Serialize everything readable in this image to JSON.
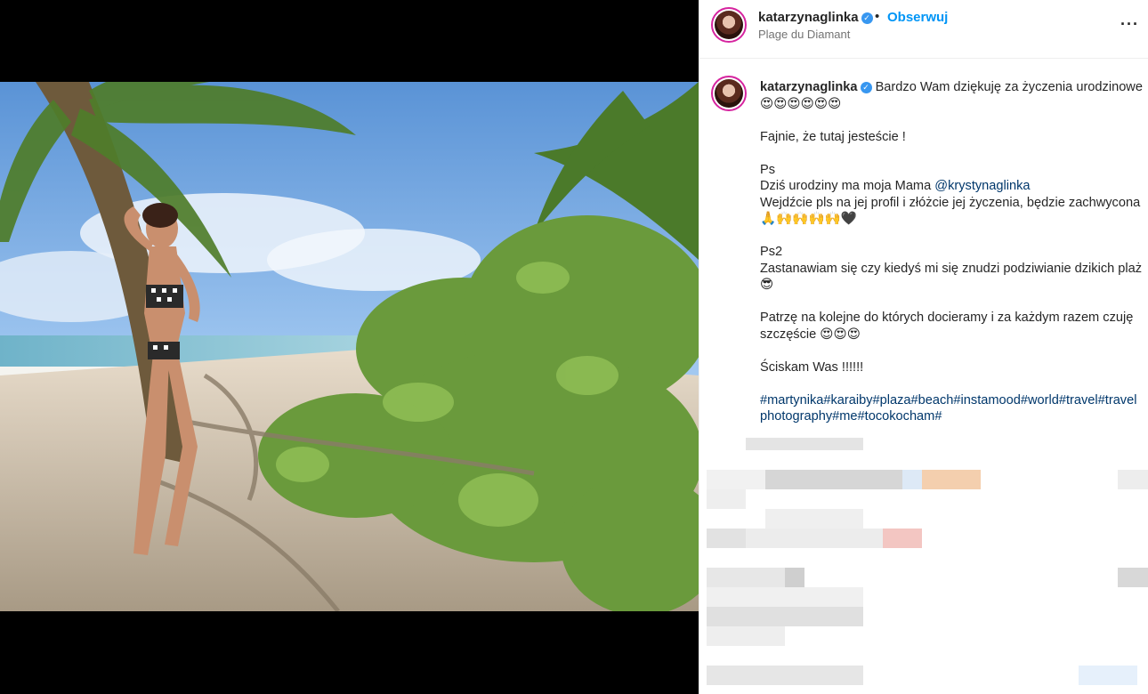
{
  "post": {
    "username": "katarzynaglinka",
    "verified_mark": "✓",
    "dot": "•",
    "follow_label": "Obserwuj",
    "location": "Plage du Diamant",
    "more_label": "···"
  },
  "caption": {
    "username": "katarzynaglinka",
    "line1": " Bardzo Wam dziękuję za życzenia urodzinowe 😍😍😍😍😍😍",
    "line2": "Fajnie, że tutaj jesteście !",
    "line3": "Ps",
    "line4_pre": "Dziś urodziny ma moja Mama ",
    "mention": "@krystynaglinka",
    "line5": "Wejdźcie pls na jej profil i złóżcie jej życzenia, będzie zachwycona 🙏🙌🙌🙌🙌🖤",
    "line6": "Ps2",
    "line7": "Zastanawiam się czy kiedyś mi się znudzi podziwianie dzikich plaż 😎",
    "line8": "Patrzę na kolejne do których docieramy i za każdym razem czuję szczęście 😍😍😍",
    "line9": "Ściskam Was !!!!!!",
    "hashtags": "#martynika#karaiby#plaza#beach#instamood#world#travel#travelphotography#me#tocokocham#"
  },
  "colors": {
    "link": "#0095f6",
    "mention": "#00376b",
    "story_ring": "#d6249f"
  },
  "icons": {
    "verified": "verified-badge-icon",
    "more": "more-options-icon"
  }
}
